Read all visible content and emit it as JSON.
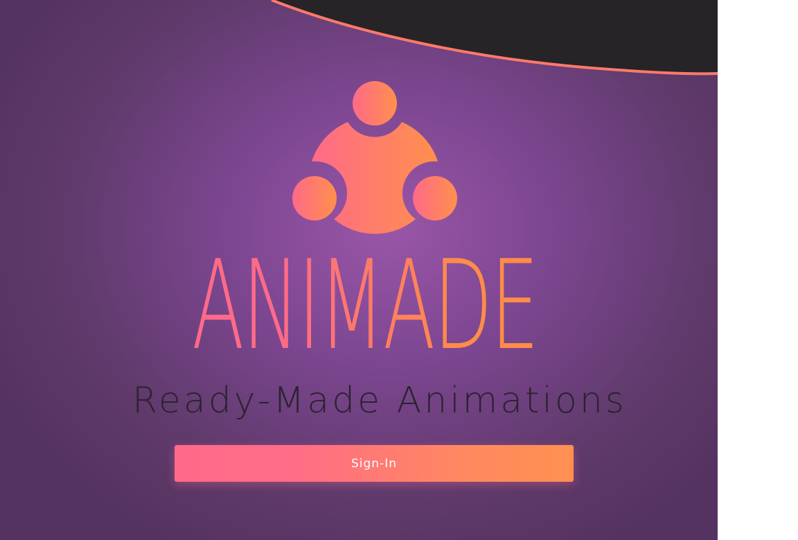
{
  "app": {
    "brand_name": "ANIMADE",
    "tagline": "Ready-Made Animations"
  },
  "actions": {
    "sign_in_label": "Sign-In"
  },
  "icons": {
    "logo": "community-logo-icon"
  },
  "colors": {
    "background_center": "#9a56a8",
    "background_edge": "#553360",
    "accent_pink": "#ff6a88",
    "accent_orange": "#ff8c48",
    "wave_fill": "#262426",
    "wave_stroke": "#ff7a6a",
    "tagline_text": "#2b2330",
    "button_text": "#ffffff"
  }
}
